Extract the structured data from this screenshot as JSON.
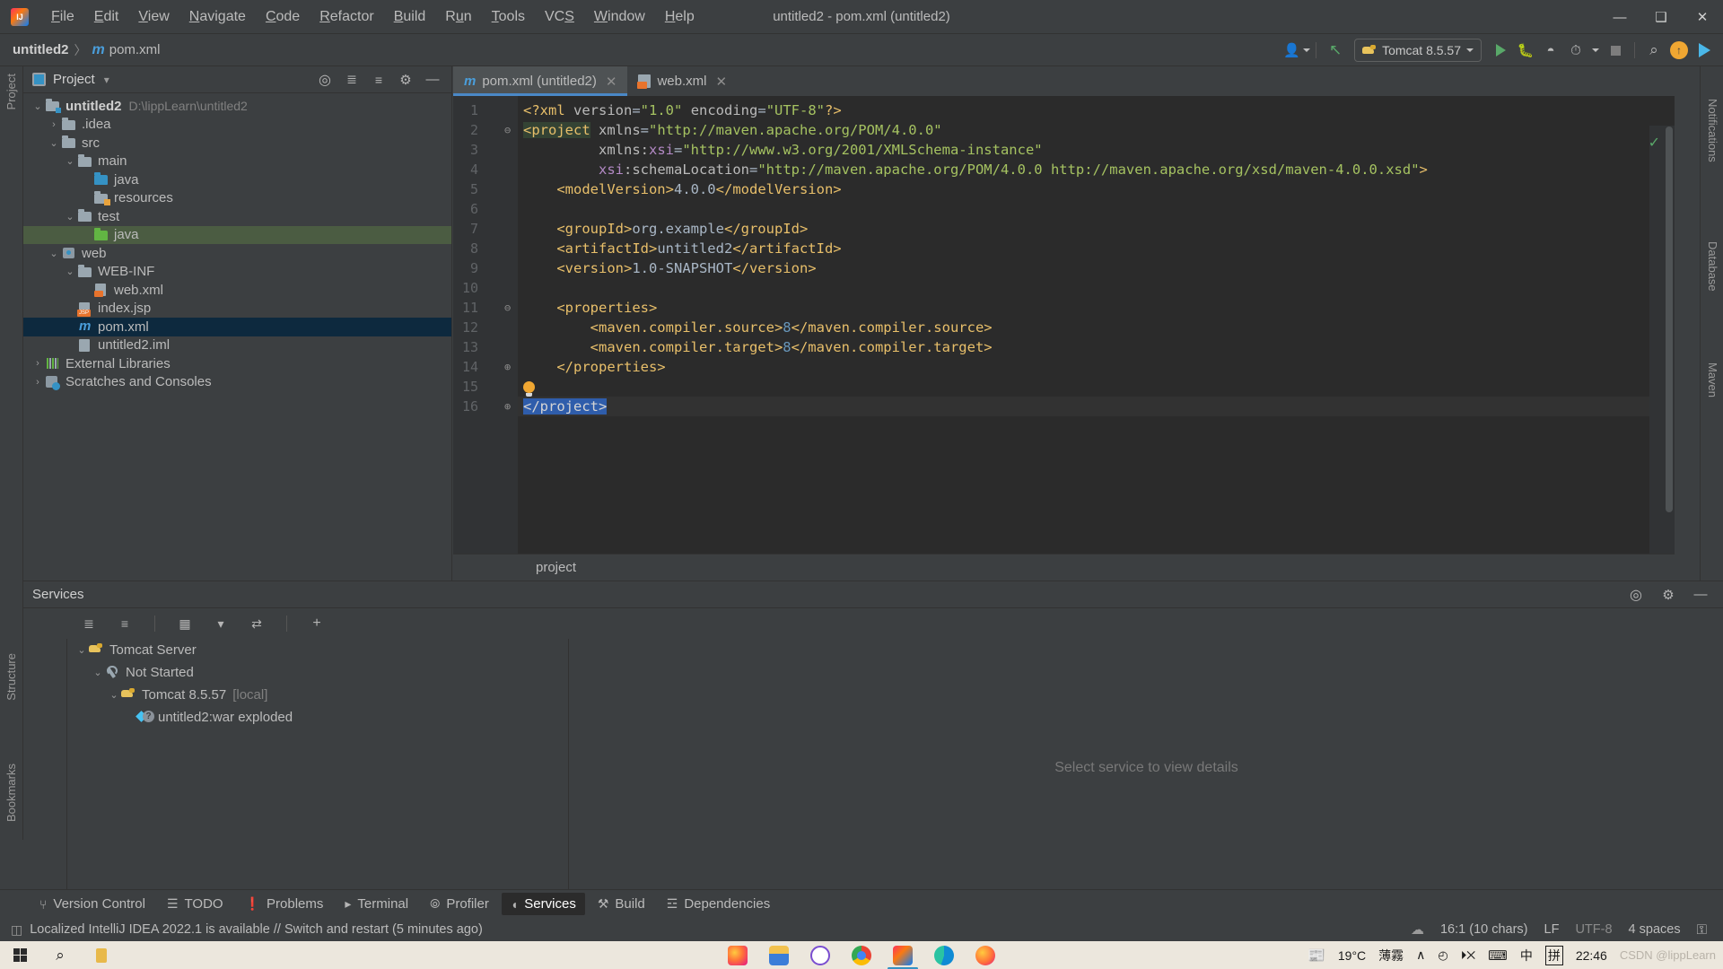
{
  "window": {
    "title": "untitled2 - pom.xml (untitled2)",
    "minimize": "—",
    "maximize": "❑",
    "close": "✕"
  },
  "menubar": {
    "items": [
      {
        "label": "File"
      },
      {
        "label": "Edit"
      },
      {
        "label": "View"
      },
      {
        "label": "Navigate"
      },
      {
        "label": "Code"
      },
      {
        "label": "Refactor"
      },
      {
        "label": "Build"
      },
      {
        "label": "Run"
      },
      {
        "label": "Tools"
      },
      {
        "label": "VCS"
      },
      {
        "label": "Window"
      },
      {
        "label": "Help"
      }
    ]
  },
  "navbar": {
    "project": "untitled2",
    "separator": "〉",
    "file": "pom.xml",
    "maven_glyph": "m"
  },
  "toolbar": {
    "run_config": "Tomcat 8.5.57",
    "search_glyph": "⌕",
    "update_glyph": "↑",
    "account_glyph": "☺",
    "build_glyph": "↖"
  },
  "left_strip": {
    "top_label": "Project",
    "bottom_labels": [
      "Structure",
      "Bookmarks"
    ]
  },
  "right_strip": {
    "labels": [
      "Notifications",
      "Database",
      "Maven"
    ]
  },
  "project_panel": {
    "title": "Project",
    "dropdown_glyph": "▾",
    "tree": [
      {
        "indent": 0,
        "twisty": "⌄",
        "icon": "module-folder-icon",
        "label": "untitled2",
        "path": "D:\\lippLearn\\untitled2",
        "bold": true,
        "state": "none"
      },
      {
        "indent": 1,
        "twisty": "›",
        "icon": "folder-icon",
        "label": ".idea",
        "path": "",
        "bold": false,
        "state": "none"
      },
      {
        "indent": 1,
        "twisty": "⌄",
        "icon": "folder-icon",
        "label": "src",
        "path": "",
        "bold": false,
        "state": "none"
      },
      {
        "indent": 2,
        "twisty": "⌄",
        "icon": "folder-icon",
        "label": "main",
        "path": "",
        "bold": false,
        "state": "none"
      },
      {
        "indent": 3,
        "twisty": "",
        "icon": "source-folder-icon",
        "label": "java",
        "path": "",
        "bold": false,
        "state": "none"
      },
      {
        "indent": 3,
        "twisty": "",
        "icon": "resource-folder-icon",
        "label": "resources",
        "path": "",
        "bold": false,
        "state": "none"
      },
      {
        "indent": 2,
        "twisty": "⌄",
        "icon": "folder-icon",
        "label": "test",
        "path": "",
        "bold": false,
        "state": "none"
      },
      {
        "indent": 3,
        "twisty": "",
        "icon": "test-source-folder-icon",
        "label": "java",
        "path": "",
        "bold": false,
        "state": "green"
      },
      {
        "indent": 1,
        "twisty": "⌄",
        "icon": "web-folder-icon",
        "label": "web",
        "path": "",
        "bold": false,
        "state": "none"
      },
      {
        "indent": 2,
        "twisty": "⌄",
        "icon": "folder-icon",
        "label": "WEB-INF",
        "path": "",
        "bold": false,
        "state": "none"
      },
      {
        "indent": 3,
        "twisty": "",
        "icon": "xml-file-icon",
        "label": "web.xml",
        "path": "",
        "bold": false,
        "state": "none"
      },
      {
        "indent": 2,
        "twisty": "",
        "icon": "jsp-file-icon",
        "label": "index.jsp",
        "path": "",
        "bold": false,
        "state": "none"
      },
      {
        "indent": 2,
        "twisty": "",
        "icon": "maven-pom-icon",
        "label": "pom.xml",
        "path": "",
        "bold": false,
        "state": "blue"
      },
      {
        "indent": 2,
        "twisty": "",
        "icon": "iml-file-icon",
        "label": "untitled2.iml",
        "path": "",
        "bold": false,
        "state": "none"
      },
      {
        "indent": 0,
        "twisty": "›",
        "icon": "external-libraries-icon",
        "label": "External Libraries",
        "path": "",
        "bold": false,
        "state": "none"
      },
      {
        "indent": 0,
        "twisty": "›",
        "icon": "scratches-icon",
        "label": "Scratches and Consoles",
        "path": "",
        "bold": false,
        "state": "none"
      }
    ]
  },
  "editor": {
    "tabs": [
      {
        "label": "pom.xml (untitled2)",
        "icon": "maven-pom-icon",
        "active": true,
        "close": "✕"
      },
      {
        "label": "web.xml",
        "icon": "xml-file-icon",
        "active": false,
        "close": "✕"
      }
    ],
    "breadcrumb": "project",
    "inspection_ok": "✓",
    "line_numbers": [
      "1",
      "2",
      "3",
      "4",
      "5",
      "6",
      "7",
      "8",
      "9",
      "10",
      "11",
      "12",
      "13",
      "14",
      "15",
      "16"
    ],
    "code_lines": [
      {
        "n": 1,
        "segments": [
          {
            "t": "<?xml ",
            "c": "tagn"
          },
          {
            "t": "version",
            "c": "attr"
          },
          {
            "t": "=",
            "c": "eq"
          },
          {
            "t": "\"1.0\"",
            "c": "attrv"
          },
          {
            "t": " ",
            "c": "txtv"
          },
          {
            "t": "encoding",
            "c": "attr"
          },
          {
            "t": "=",
            "c": "eq"
          },
          {
            "t": "\"UTF-8\"",
            "c": "attrv"
          },
          {
            "t": "?>",
            "c": "tagn"
          }
        ]
      },
      {
        "n": 2,
        "segments": [
          {
            "t": "<project",
            "c": "tagn hl-prj"
          },
          {
            "t": " ",
            "c": "txtv"
          },
          {
            "t": "xmlns",
            "c": "attr"
          },
          {
            "t": "=",
            "c": "eq"
          },
          {
            "t": "\"http://maven.apache.org/POM/4.0.0\"",
            "c": "attrv"
          }
        ]
      },
      {
        "n": 3,
        "segments": [
          {
            "t": "         ",
            "c": "txtv"
          },
          {
            "t": "xmlns:",
            "c": "attr"
          },
          {
            "t": "xsi",
            "c": "nsx"
          },
          {
            "t": "=",
            "c": "eq"
          },
          {
            "t": "\"http://www.w3.org/2001/XMLSchema-instance\"",
            "c": "attrv"
          }
        ]
      },
      {
        "n": 4,
        "segments": [
          {
            "t": "         ",
            "c": "txtv"
          },
          {
            "t": "xsi",
            "c": "nsx"
          },
          {
            "t": ":schemaLocation",
            "c": "attr"
          },
          {
            "t": "=",
            "c": "eq"
          },
          {
            "t": "\"http://maven.apache.org/POM/4.0.0 http://maven.apache.org/xsd/maven-4.0.0.xsd\"",
            "c": "attrv"
          },
          {
            "t": ">",
            "c": "tagn"
          }
        ]
      },
      {
        "n": 5,
        "segments": [
          {
            "t": "    <modelVersion>",
            "c": "tagn"
          },
          {
            "t": "4.0.0",
            "c": "txtv"
          },
          {
            "t": "</modelVersion>",
            "c": "tagn"
          }
        ]
      },
      {
        "n": 6,
        "segments": []
      },
      {
        "n": 7,
        "segments": [
          {
            "t": "    <groupId>",
            "c": "tagn"
          },
          {
            "t": "org.example",
            "c": "txtv"
          },
          {
            "t": "</groupId>",
            "c": "tagn"
          }
        ]
      },
      {
        "n": 8,
        "segments": [
          {
            "t": "    <artifactId>",
            "c": "tagn"
          },
          {
            "t": "untitled2",
            "c": "txtv"
          },
          {
            "t": "</artifactId>",
            "c": "tagn"
          }
        ]
      },
      {
        "n": 9,
        "segments": [
          {
            "t": "    <version>",
            "c": "tagn"
          },
          {
            "t": "1.0-SNAPSHOT",
            "c": "txtv"
          },
          {
            "t": "</version>",
            "c": "tagn"
          }
        ]
      },
      {
        "n": 10,
        "segments": []
      },
      {
        "n": 11,
        "segments": [
          {
            "t": "    <properties>",
            "c": "tagn"
          }
        ]
      },
      {
        "n": 12,
        "segments": [
          {
            "t": "        <maven.compiler.source>",
            "c": "tagn"
          },
          {
            "t": "8",
            "c": "num"
          },
          {
            "t": "</maven.compiler.source>",
            "c": "tagn"
          }
        ]
      },
      {
        "n": 13,
        "segments": [
          {
            "t": "        <maven.compiler.target>",
            "c": "tagn"
          },
          {
            "t": "8",
            "c": "num"
          },
          {
            "t": "</maven.compiler.target>",
            "c": "tagn"
          }
        ]
      },
      {
        "n": 14,
        "segments": [
          {
            "t": "    </properties>",
            "c": "tagn"
          }
        ]
      },
      {
        "n": 15,
        "segments": []
      },
      {
        "n": 16,
        "segments": [
          {
            "t": "</project>",
            "c": "tagn selblue"
          }
        ]
      }
    ]
  },
  "services": {
    "title": "Services",
    "placeholder": "Select service to view details",
    "tree": [
      {
        "indent": 0,
        "twisty": "⌄",
        "icon": "tomcat-icon",
        "label": "Tomcat Server",
        "suffix": ""
      },
      {
        "indent": 1,
        "twisty": "⌄",
        "icon": "wrench-icon",
        "label": "Not Started",
        "suffix": ""
      },
      {
        "indent": 2,
        "twisty": "⌄",
        "icon": "tomcat-icon",
        "label": "Tomcat 8.5.57",
        "suffix": "[local]"
      },
      {
        "indent": 3,
        "twisty": "",
        "icon": "artifact-icon",
        "label": "untitled2:war exploded",
        "suffix": ""
      }
    ]
  },
  "bottom_tabs": [
    {
      "label": "Version Control",
      "icon": "branch-icon",
      "active": false
    },
    {
      "label": "TODO",
      "icon": "list-icon",
      "active": false
    },
    {
      "label": "Problems",
      "icon": "error-icon",
      "active": false
    },
    {
      "label": "Terminal",
      "icon": "terminal-icon",
      "active": false
    },
    {
      "label": "Profiler",
      "icon": "profiler-icon",
      "active": false
    },
    {
      "label": "Services",
      "icon": "services-icon",
      "active": true
    },
    {
      "label": "Build",
      "icon": "hammer-icon",
      "active": false
    },
    {
      "label": "Dependencies",
      "icon": "layers-icon",
      "active": false
    }
  ],
  "statusbar": {
    "message": "Localized IntelliJ IDEA 2022.1 is available // Switch and restart (5 minutes ago)",
    "caret": "16:1 (10 chars)",
    "line_sep": "LF",
    "encoding": "UTF-8",
    "indent": "4 spaces",
    "lock_glyph": "⚿"
  },
  "taskbar": {
    "search_glyph": "⌕",
    "temperature": "19°C",
    "weather": "薄霧",
    "chevron": "∧",
    "network_glyph": "◴",
    "volume_glyph": "⏵✕",
    "keyboard_glyph": "⌨",
    "ime_lang": "中",
    "ime_mode": "拼",
    "clock": "22:46",
    "watermark": "CSDN @lippLearn"
  }
}
